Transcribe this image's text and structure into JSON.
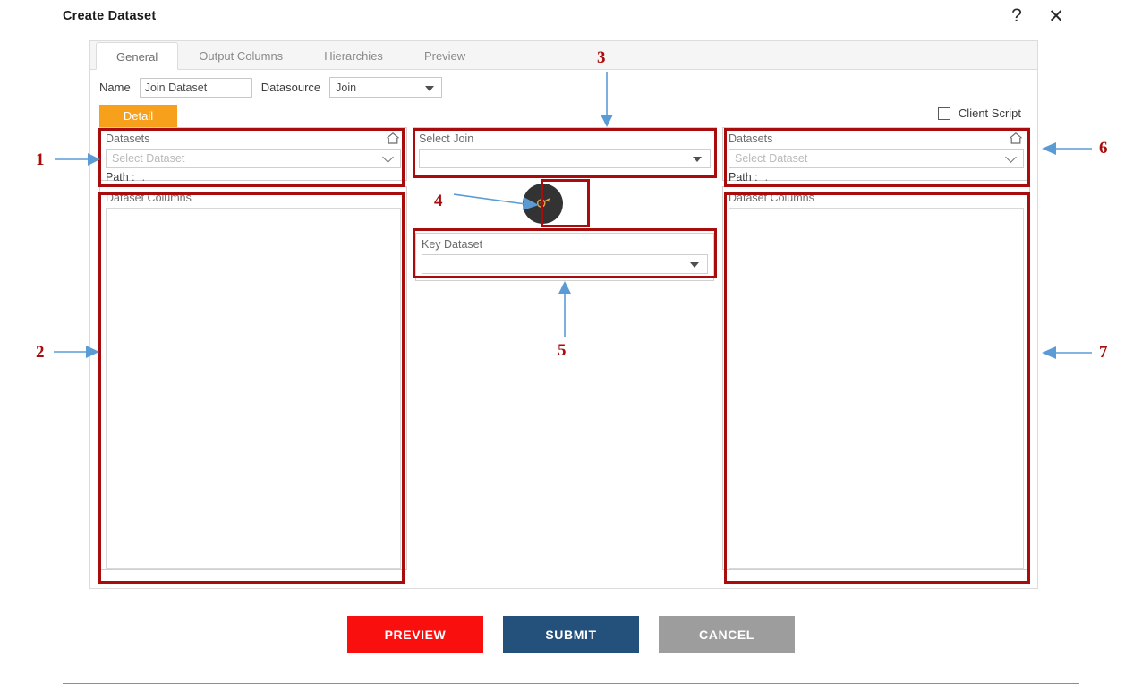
{
  "dialog": {
    "title": "Create Dataset",
    "help_icon": "question-mark-icon",
    "close_icon": "close-icon"
  },
  "tabs": [
    {
      "label": "General",
      "active": true
    },
    {
      "label": "Output Columns",
      "active": false
    },
    {
      "label": "Hierarchies",
      "active": false
    },
    {
      "label": "Preview",
      "active": false
    }
  ],
  "form": {
    "name_label": "Name",
    "name_value": "Join Dataset",
    "datasource_label": "Datasource",
    "datasource_value": "Join"
  },
  "detail_tab": {
    "label": "Detail"
  },
  "client_script": {
    "label": "Client Script",
    "checked": false
  },
  "left_panel": {
    "datasets_label": "Datasets",
    "home_icon": "home-icon",
    "select_placeholder": "Select Dataset",
    "path_label": "Path :",
    "path_value": ".",
    "columns_label": "Dataset Columns"
  },
  "mid_panel": {
    "select_join_label": "Select Join",
    "select_join_value": "",
    "key_icon": "key-icon",
    "key_dataset_label": "Key Dataset",
    "key_dataset_value": ""
  },
  "right_panel": {
    "datasets_label": "Datasets",
    "home_icon": "home-icon",
    "select_placeholder": "Select Dataset",
    "path_label": "Path :",
    "path_value": ".",
    "columns_label": "Dataset Columns"
  },
  "footer": {
    "preview_label": "PREVIEW",
    "submit_label": "SUBMIT",
    "cancel_label": "CANCEL"
  },
  "annotations": [
    {
      "number": "1",
      "direction": "right"
    },
    {
      "number": "2",
      "direction": "right"
    },
    {
      "number": "3",
      "direction": "down"
    },
    {
      "number": "4",
      "direction": "right"
    },
    {
      "number": "5",
      "direction": "up"
    },
    {
      "number": "6",
      "direction": "left"
    },
    {
      "number": "7",
      "direction": "left"
    }
  ],
  "colors": {
    "annotation_red": "#a80c0c",
    "arrow_blue": "#5b9bd5",
    "detail_orange": "#f7a01c",
    "preview_red": "#fa0f0f",
    "submit_blue": "#23517c",
    "cancel_gray": "#9d9d9d",
    "key_circle": "#333333",
    "key_glyph": "#e0a050"
  }
}
